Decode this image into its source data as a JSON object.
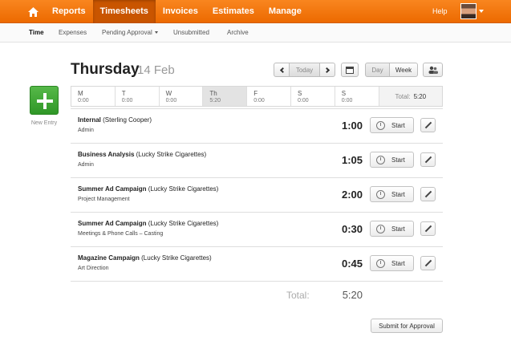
{
  "topnav": {
    "items": [
      "Reports",
      "Timesheets",
      "Invoices",
      "Estimates",
      "Manage"
    ],
    "active": "Timesheets",
    "help": "Help",
    "home_icon": "home-icon",
    "brand_color": "#f57a11"
  },
  "subnav": {
    "items": [
      "Time",
      "Expenses",
      "Pending Approval",
      "Unsubmitted",
      "Archive"
    ],
    "active": "Time"
  },
  "new_entry": {
    "label": "New Entry",
    "color": "#3fa534"
  },
  "header": {
    "day": "Thursday",
    "date": "14 Feb",
    "today": "Today",
    "view_day": "Day",
    "view_week": "Week"
  },
  "week": {
    "days": [
      {
        "label": "M",
        "time": "0:00"
      },
      {
        "label": "T",
        "time": "0:00"
      },
      {
        "label": "W",
        "time": "0:00"
      },
      {
        "label": "Th",
        "time": "5:20"
      },
      {
        "label": "F",
        "time": "0:00"
      },
      {
        "label": "S",
        "time": "0:00"
      },
      {
        "label": "S",
        "time": "0:00"
      }
    ],
    "total_label": "Total:",
    "total_value": "5:20"
  },
  "entries": [
    {
      "project": "Internal",
      "client": "(Sterling Cooper)",
      "task": "Admin",
      "duration": "1:00"
    },
    {
      "project": "Business Analysis",
      "client": "(Lucky Strike Cigarettes)",
      "task": "Admin",
      "duration": "1:05"
    },
    {
      "project": "Summer Ad Campaign",
      "client": "(Lucky Strike Cigarettes)",
      "task": "Project Management",
      "duration": "2:00"
    },
    {
      "project": "Summer Ad Campaign",
      "client": "(Lucky Strike Cigarettes)",
      "task": "Meetings & Phone Calls  –  Casting",
      "duration": "0:30"
    },
    {
      "project": "Magazine Campaign",
      "client": "(Lucky Strike Cigarettes)",
      "task": "Art Direction",
      "duration": "0:45"
    }
  ],
  "start_label": "Start",
  "total": {
    "label": "Total:",
    "value": "5:20"
  },
  "submit_label": "Submit for Approval"
}
